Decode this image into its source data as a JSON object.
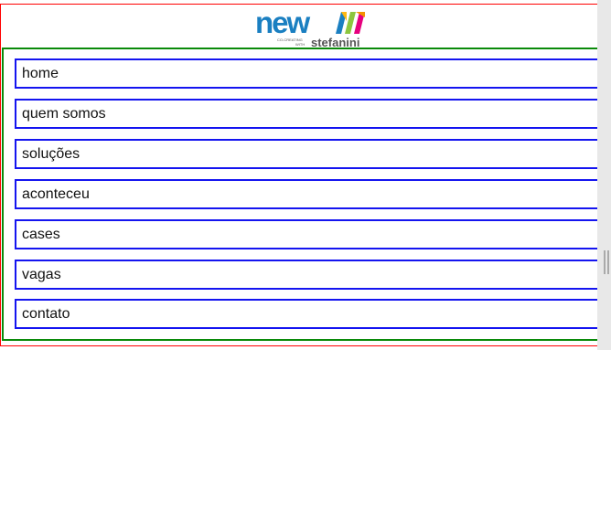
{
  "brand": {
    "logo_text": "new",
    "tagline_small": "CO-CREATING WITH",
    "tagline": "stefanini"
  },
  "nav": {
    "items": [
      {
        "label": "home"
      },
      {
        "label": "quem somos"
      },
      {
        "label": "soluções"
      },
      {
        "label": "aconteceu"
      },
      {
        "label": "cases"
      },
      {
        "label": "vagas"
      },
      {
        "label": "contato"
      }
    ]
  },
  "colors": {
    "header_border": "#ff0000",
    "nav_border": "#0a8a0a",
    "item_border": "#1414f0",
    "logo_blue": "#1a7fc1"
  }
}
